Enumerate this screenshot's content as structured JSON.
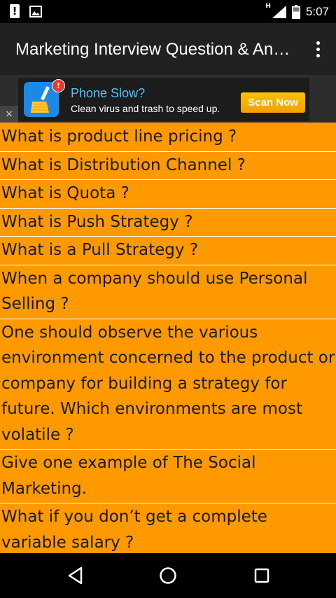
{
  "status_bar": {
    "time": "5:07",
    "network_type": "H",
    "icons": [
      "alert-icon",
      "photo-icon",
      "signal-icon",
      "battery-icon"
    ]
  },
  "app_bar": {
    "title": "Marketing Interview Question & Answers",
    "menu_icon": "more-vert-icon"
  },
  "ad": {
    "headline": "Phone Slow?",
    "description": "Clean virus and trash to speed up.",
    "cta": "Scan Now",
    "badge": "!",
    "close": "×",
    "app_icon": "broom-cleaner-icon"
  },
  "questions": [
    "What is product line pricing ?",
    "What is Distribution Channel ?",
    "What is Quota ?",
    "What is Push Strategy ?",
    "What is a Pull Strategy ?",
    "When a company should use Personal Selling ?",
    "One should observe the various environment concerned to the product or company for building a strategy for future. Which environments are most volatile ?",
    "Give one example of The Social Marketing.",
    "What if you don’t get a complete variable salary ?"
  ],
  "colors": {
    "list_background": "#ff9900",
    "app_bar": "#212121",
    "ad_headline": "#4fc3f7",
    "ad_cta": "#ffc107"
  },
  "nav_bar": {
    "buttons": [
      "back-icon",
      "home-icon",
      "recents-icon"
    ]
  }
}
